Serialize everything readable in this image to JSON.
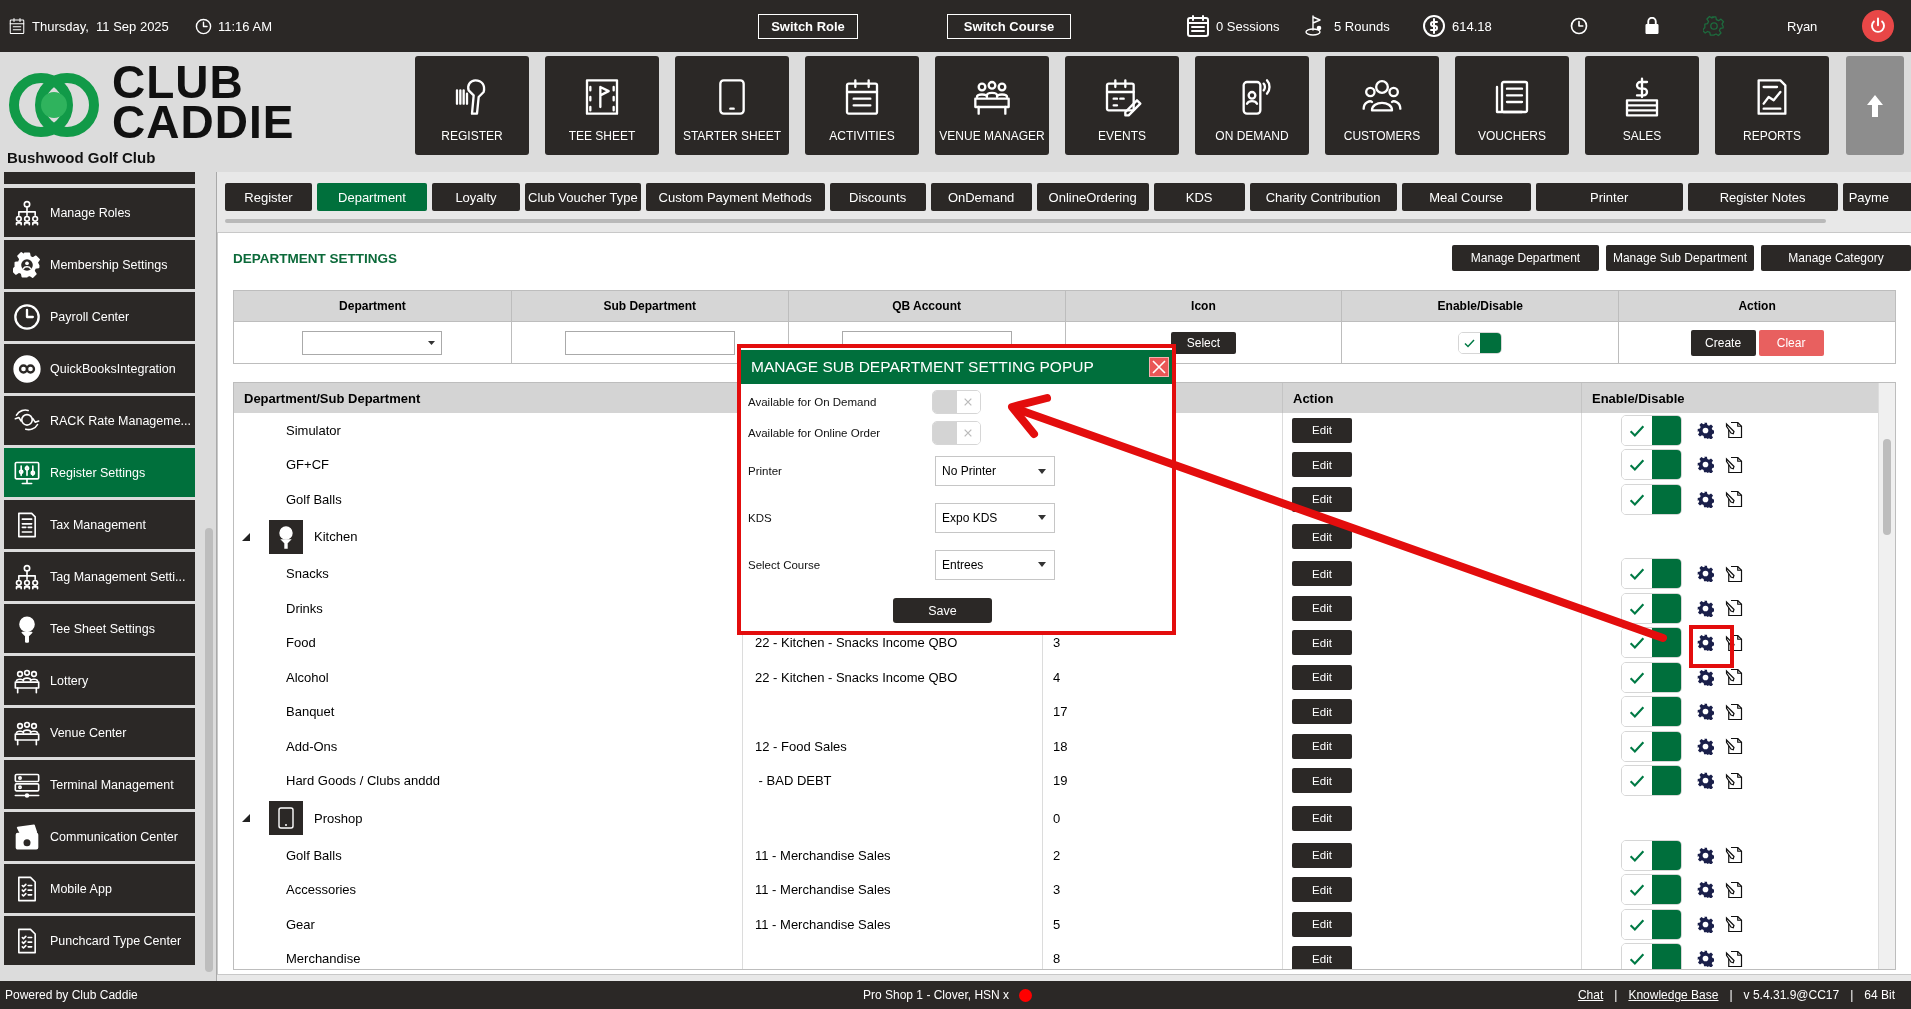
{
  "top_bar": {
    "date": "Thursday,  11 Sep 2025",
    "time": "11:16 AM",
    "buttons": [
      "Switch Role",
      "Switch Course"
    ],
    "sessions": "0 Sessions",
    "rounds": "5 Rounds",
    "balance": "614.18",
    "user": "Ryan"
  },
  "logo": {
    "line_1": "CLUB",
    "line_2": "CADDIE",
    "club_name": "Bushwood Golf Club"
  },
  "nav": [
    "REGISTER",
    "TEE SHEET",
    "STARTER SHEET",
    "ACTIVITIES",
    "VENUE MANAGER",
    "EVENTS",
    "ON DEMAND",
    "CUSTOMERS",
    "VOUCHERS",
    "SALES",
    "REPORTS"
  ],
  "sidebar": {
    "items": [
      {
        "label": "Manage Roles",
        "selected": false
      },
      {
        "label": "Membership Settings",
        "selected": false
      },
      {
        "label": "Payroll Center",
        "selected": false
      },
      {
        "label": "QuickBooksIntegration",
        "selected": false
      },
      {
        "label": "RACK Rate Manageme...",
        "selected": false
      },
      {
        "label": "Register Settings",
        "selected": true
      },
      {
        "label": "Tax Management",
        "selected": false
      },
      {
        "label": "Tag Management Setti...",
        "selected": false
      },
      {
        "label": "Tee Sheet Settings",
        "selected": false
      },
      {
        "label": "Lottery",
        "selected": false
      },
      {
        "label": "Venue Center",
        "selected": false
      },
      {
        "label": "Terminal Management",
        "selected": false
      },
      {
        "label": "Communication Center",
        "selected": false
      },
      {
        "label": "Mobile App",
        "selected": false
      },
      {
        "label": "Punchcard Type Center",
        "selected": false
      }
    ]
  },
  "tabs": [
    {
      "label": "Register",
      "selected": false
    },
    {
      "label": "Department",
      "selected": true
    },
    {
      "label": "Loyalty",
      "selected": false
    },
    {
      "label": "Club Voucher Type",
      "selected": false
    },
    {
      "label": "Custom Payment Methods",
      "selected": false
    },
    {
      "label": "Discounts",
      "selected": false
    },
    {
      "label": "OnDemand",
      "selected": false
    },
    {
      "label": "OnlineOrdering",
      "selected": false
    },
    {
      "label": "KDS",
      "selected": false
    },
    {
      "label": "Charity Contribution",
      "selected": false
    },
    {
      "label": "Meal Course",
      "selected": false
    },
    {
      "label": "Printer",
      "selected": false
    },
    {
      "label": "Register Notes",
      "selected": false
    },
    {
      "label": "Payme",
      "selected": false
    }
  ],
  "department_settings": {
    "title": "DEPARTMENT SETTINGS",
    "buttons": [
      "Manage Department",
      "Manage Sub Department",
      "Manage Category"
    ],
    "form": {
      "columns": [
        "Department",
        "Sub Department",
        "QB Account",
        "Icon",
        "Enable/Disable",
        "Action"
      ],
      "icon_button": "Select",
      "enabled": true,
      "buttons": [
        {
          "label": "Create",
          "kind": "primary"
        },
        {
          "label": "Clear",
          "kind": "danger"
        }
      ]
    }
  },
  "list": {
    "header": {
      "column_1": "Department/Sub Department",
      "column_4": "Action",
      "column_5": "Enable/Disable"
    },
    "rows": [
      {
        "kind": "sub",
        "name": "Simulator",
        "action": "Edit",
        "enabled": true
      },
      {
        "kind": "sub",
        "name": "GF+CF",
        "action": "Edit",
        "enabled": true
      },
      {
        "kind": "sub",
        "name": "Golf Balls",
        "action": "Edit",
        "enabled": true
      },
      {
        "kind": "department",
        "name": "Kitchen",
        "expanded": true,
        "action": "Edit"
      },
      {
        "kind": "sub",
        "name": "Snacks",
        "action": "Edit",
        "enabled": true
      },
      {
        "kind": "sub",
        "name": "Drinks",
        "action": "Edit",
        "enabled": true
      },
      {
        "kind": "sub",
        "name": "Food",
        "qb_account": "22 - Kitchen - Snacks Income QBO",
        "column_3": "3",
        "action": "Edit",
        "enabled": true
      },
      {
        "kind": "sub",
        "name": "Alcohol",
        "qb_account": "22 - Kitchen - Snacks Income QBO",
        "column_3": "4",
        "action": "Edit",
        "enabled": true
      },
      {
        "kind": "sub",
        "name": "Banquet",
        "column_3": "17",
        "action": "Edit",
        "enabled": true
      },
      {
        "kind": "sub",
        "name": "Add-Ons",
        "qb_account": "12 - Food Sales",
        "column_3": "18",
        "action": "Edit",
        "enabled": true
      },
      {
        "kind": "sub",
        "name": "Hard Goods / Clubs anddd",
        "qb_account": " - BAD DEBT",
        "column_3": "19",
        "action": "Edit",
        "enabled": true
      },
      {
        "kind": "department",
        "name": "Proshop",
        "expanded": true,
        "column_3": "0",
        "action": "Edit"
      },
      {
        "kind": "sub",
        "name": "Golf Balls",
        "qb_account": "11 - Merchandise Sales",
        "column_3": "2",
        "action": "Edit",
        "enabled": true
      },
      {
        "kind": "sub",
        "name": "Accessories",
        "qb_account": "11 - Merchandise Sales",
        "column_3": "3",
        "action": "Edit",
        "enabled": true
      },
      {
        "kind": "sub",
        "name": "Gear",
        "qb_account": "11 - Merchandise Sales",
        "column_3": "5",
        "action": "Edit",
        "enabled": true
      },
      {
        "kind": "sub",
        "name": "Merchandise",
        "column_3": "8",
        "action": "Edit",
        "enabled": true
      }
    ]
  },
  "popup": {
    "title": "MANAGE SUB DEPARTMENT SETTING POPUP",
    "fields": [
      {
        "kind": "toggle",
        "label": "Available for On Demand",
        "on": false
      },
      {
        "kind": "toggle",
        "label": "Available for Online Order",
        "on": false
      },
      {
        "kind": "select",
        "label": "Printer",
        "value": "No Printer"
      },
      {
        "kind": "select",
        "label": "KDS",
        "value": "Expo KDS"
      },
      {
        "kind": "select",
        "label": "Select Course",
        "value": "Entrees"
      }
    ],
    "save": "Save"
  },
  "status_bar": {
    "powered_by": "Powered by Club Caddie",
    "terminal": "Pro Shop 1 - Clover, HSN x",
    "right": [
      {
        "kind": "link",
        "text": "Chat"
      },
      {
        "kind": "separator",
        "text": "|"
      },
      {
        "kind": "link",
        "text": "Knowledge Base"
      },
      {
        "kind": "separator",
        "text": "|"
      },
      {
        "kind": "text",
        "text": "v 5.4.31.9@CC17"
      },
      {
        "kind": "separator",
        "text": "|"
      },
      {
        "kind": "text",
        "text": "64 Bit"
      }
    ]
  }
}
